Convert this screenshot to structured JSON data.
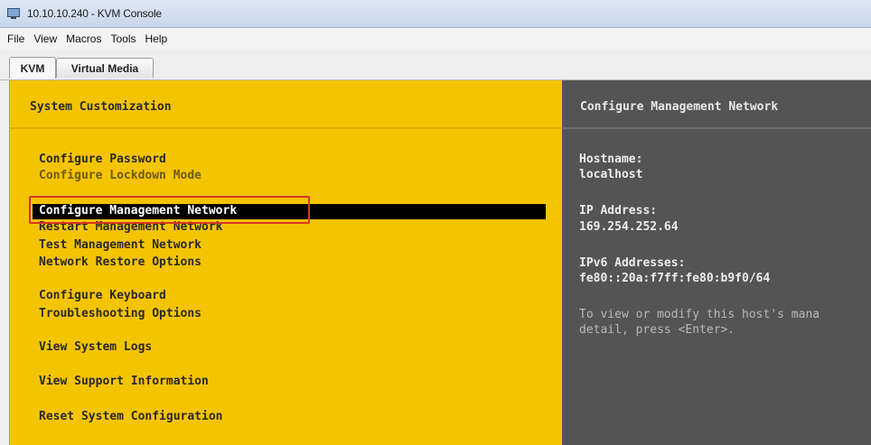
{
  "window": {
    "title": "10.10.10.240 - KVM Console",
    "icon": "monitor-icon"
  },
  "menubar": {
    "items": [
      "File",
      "View",
      "Macros",
      "Tools",
      "Help"
    ]
  },
  "tabs": {
    "items": [
      "KVM",
      "Virtual Media"
    ],
    "active": "KVM"
  },
  "console": {
    "left_header": "System Customization",
    "options": [
      "Configure Password",
      "Configure Lockdown Mode",
      "Configure Management Network",
      "Restart Management Network",
      "Test Management Network",
      "Network Restore Options",
      "Configure Keyboard",
      "Troubleshooting Options",
      "View System Logs",
      "View Support Information",
      "Reset System Configuration"
    ],
    "selected_option": "Configure Management Network",
    "right_header": "Configure Management Network",
    "hostname_label": "Hostname:",
    "hostname_value": "localhost",
    "ip_label": "IP Address:",
    "ip_value": "169.254.252.64",
    "ipv6_label": "IPv6 Addresses:",
    "ipv6_value": "fe80::20a:f7ff:fe80:b9f0/64",
    "help_line1": "To view or modify this host's mana",
    "help_line2": "detail, press <Enter>."
  },
  "colors": {
    "left_pane": "#f5c400",
    "right_pane": "#545454",
    "highlight_box": "#d9361f"
  }
}
